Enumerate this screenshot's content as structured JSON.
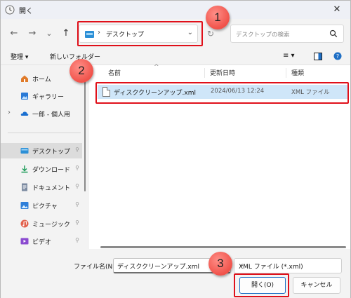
{
  "window": {
    "title": "開く",
    "close_glyph": "✕"
  },
  "nav": {
    "back_glyph": "←",
    "forward_glyph": "→",
    "recent_glyph": "⌄",
    "up_glyph": "↑",
    "breadcrumb_sep": "›",
    "address_path": "デスクトップ",
    "address_dropdown": "⌄",
    "refresh_glyph": "↻",
    "search_placeholder": "デスクトップの検索"
  },
  "commandbar": {
    "organize": "整理 ▾",
    "new_folder": "新しいフォルダー",
    "view_glyph": "≡ ▾"
  },
  "sidebar": {
    "items": [
      {
        "label": "ホーム",
        "icon": "home-icon",
        "color": "#e07b2a"
      },
      {
        "label": "ギャラリー",
        "icon": "gallery-icon",
        "color": "#2a7ad6"
      },
      {
        "label": "一郎 - 個人用",
        "icon": "onedrive-icon",
        "color": "#1a6fd0",
        "chevron": "›"
      },
      {
        "label": "デスクトップ",
        "icon": "desktop-icon",
        "color": "#2c8fd6",
        "pin": "📌"
      },
      {
        "label": "ダウンロード",
        "icon": "download-icon",
        "color": "#1e9c5a",
        "pin": "📌"
      },
      {
        "label": "ドキュメント",
        "icon": "documents-icon",
        "color": "#6b7a8f",
        "pin": "📌"
      },
      {
        "label": "ピクチャ",
        "icon": "pictures-icon",
        "color": "#2f7fd9",
        "pin": "📌"
      },
      {
        "label": "ミュージック",
        "icon": "music-icon",
        "color": "#e2624e",
        "pin": "📌"
      },
      {
        "label": "ビデオ",
        "icon": "videos-icon",
        "color": "#8a4ad0",
        "pin": "📌"
      }
    ]
  },
  "filelist": {
    "columns": [
      "名前",
      "更新日時",
      "種類"
    ],
    "sort_caret": "^",
    "rows": [
      {
        "name": "ディスククリーンアップ.xml",
        "modified": "2024/06/13 12:24",
        "type": "XML ファイル"
      }
    ]
  },
  "footer": {
    "filename_label": "ファイル名(N):",
    "filename_value": "ディスククリーンアップ.xml",
    "filetype_value": "XML ファイル (*.xml)",
    "dropdown_glyph": "⌄",
    "open_button": "開く(O)",
    "cancel_button": "キャンセル"
  },
  "annotations": {
    "badges": [
      "1",
      "2",
      "3"
    ],
    "highlight_color": "#e0101a",
    "badge_color": "#f0524a"
  }
}
